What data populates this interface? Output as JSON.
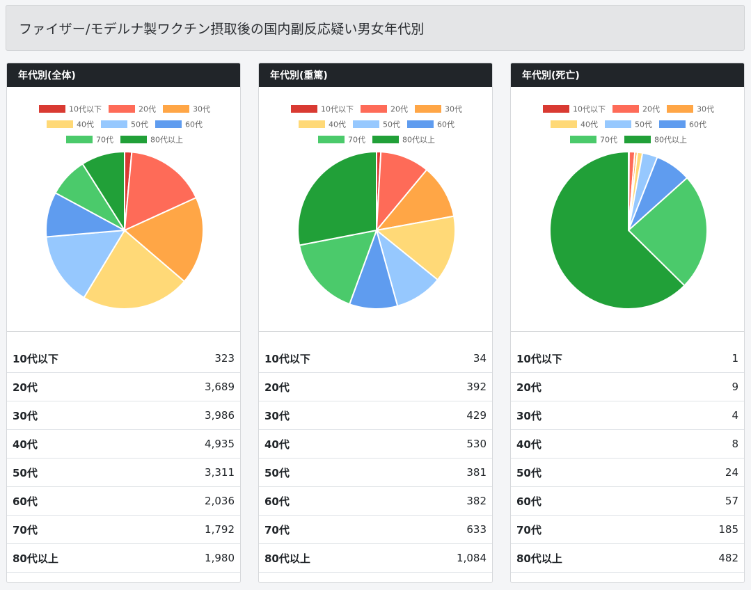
{
  "page": {
    "title": "ファイザー/モデルナ製ワクチン摂取後の国内副反応疑い男女年代別"
  },
  "colors": {
    "palette": [
      "#d93a32",
      "#fe6b58",
      "#ffa646",
      "#ffd977",
      "#96c8fe",
      "#5f9cef",
      "#4bca6b",
      "#21a038"
    ]
  },
  "chart_data": [
    {
      "type": "pie",
      "title": "年代別(全体)",
      "categories": [
        "10代以下",
        "20代",
        "30代",
        "40代",
        "50代",
        "60代",
        "70代",
        "80代以上"
      ],
      "values": [
        323,
        3689,
        3986,
        4935,
        3311,
        2036,
        1792,
        1980
      ],
      "value_labels": [
        "323",
        "3,689",
        "3,986",
        "4,935",
        "3,311",
        "2,036",
        "1,792",
        "1,980"
      ],
      "legend": "top"
    },
    {
      "type": "pie",
      "title": "年代別(重篤)",
      "categories": [
        "10代以下",
        "20代",
        "30代",
        "40代",
        "50代",
        "60代",
        "70代",
        "80代以上"
      ],
      "values": [
        34,
        392,
        429,
        530,
        381,
        382,
        633,
        1084
      ],
      "value_labels": [
        "34",
        "392",
        "429",
        "530",
        "381",
        "382",
        "633",
        "1,084"
      ],
      "legend": "top"
    },
    {
      "type": "pie",
      "title": "年代別(死亡)",
      "categories": [
        "10代以下",
        "20代",
        "30代",
        "40代",
        "50代",
        "60代",
        "70代",
        "80代以上"
      ],
      "values": [
        1,
        9,
        4,
        8,
        24,
        57,
        185,
        482
      ],
      "value_labels": [
        "1",
        "9",
        "4",
        "8",
        "24",
        "57",
        "185",
        "482"
      ],
      "legend": "top"
    }
  ]
}
